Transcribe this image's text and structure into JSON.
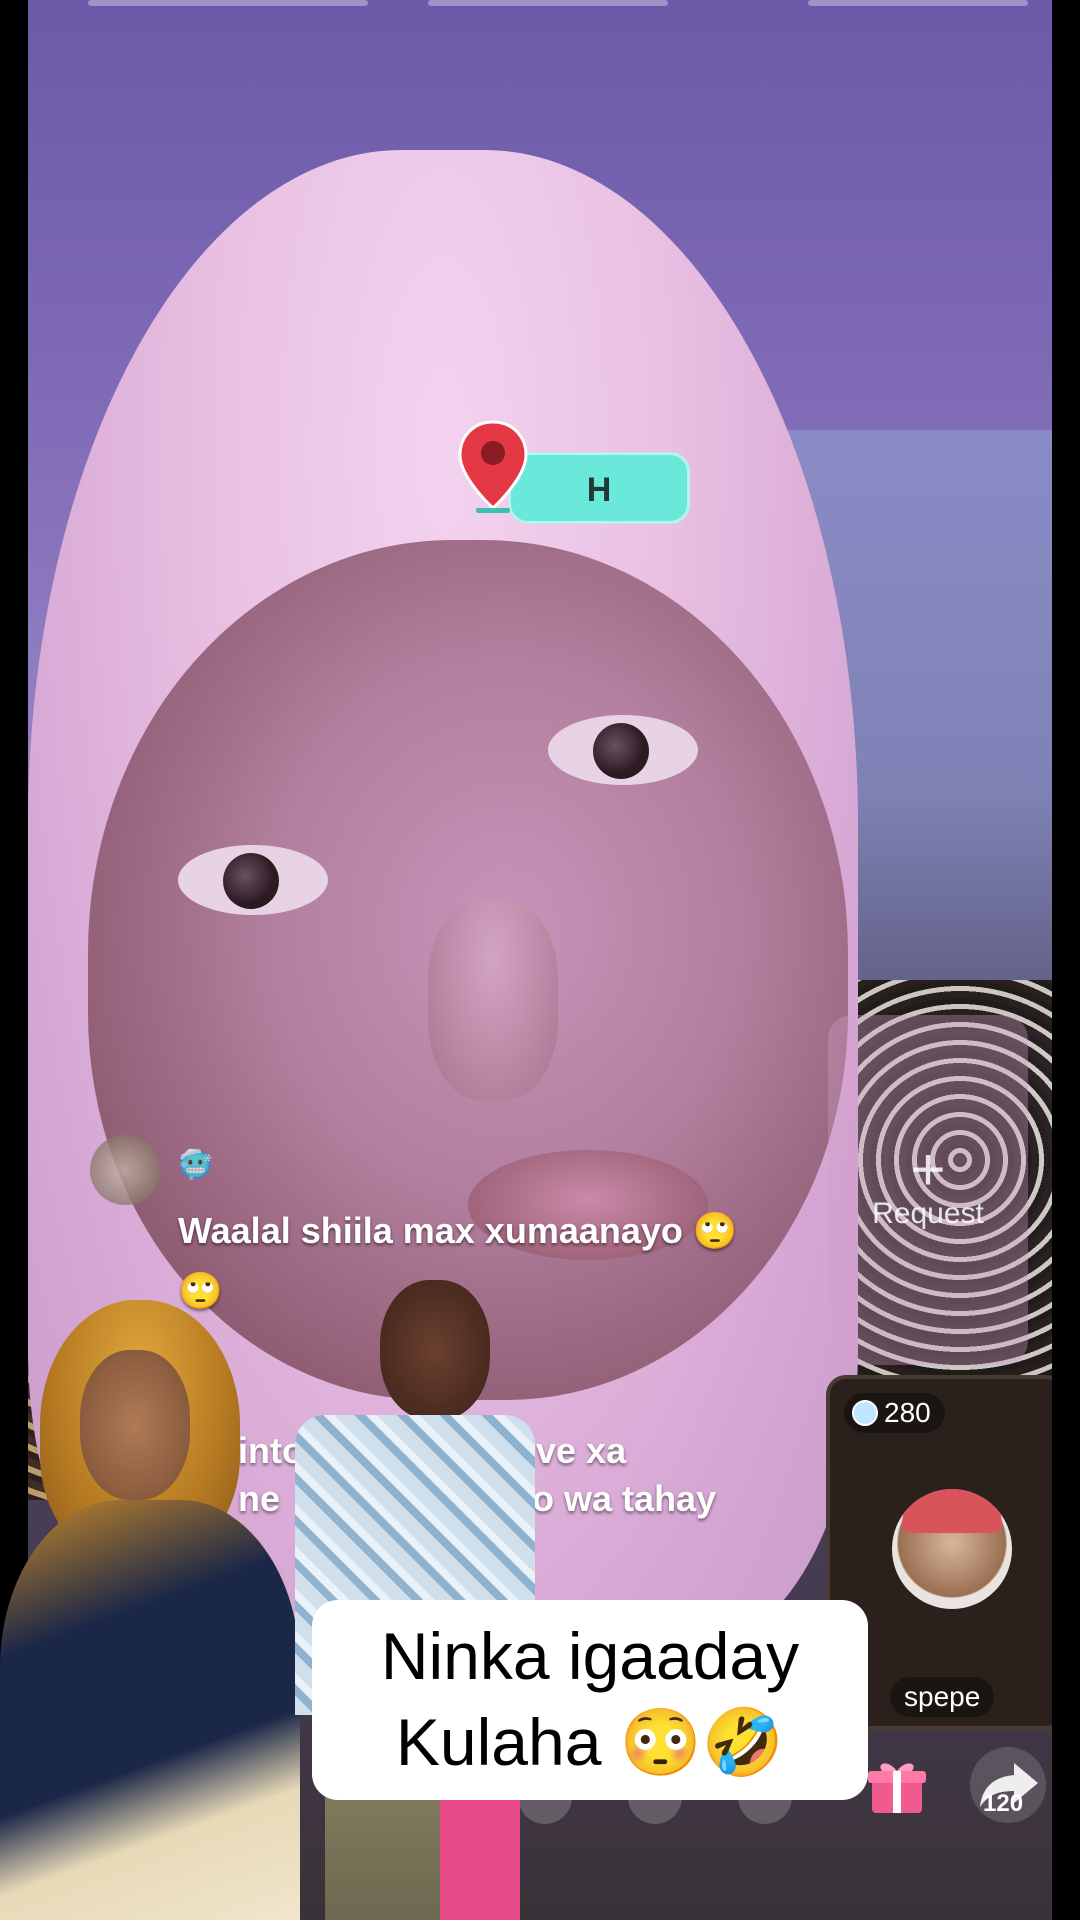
{
  "location_sticker": {
    "label": "H",
    "pin_color": "#e53845",
    "pill_color": "#6ae8da"
  },
  "comments": [
    {
      "line1": "Waalal shiila max xumaanayo 🙄",
      "line2": "🙄"
    },
    {
      "line1": "Go into t",
      "line1_end": "ve xa",
      "line2": "ne",
      "line2_end": "po wa tahay"
    }
  ],
  "request_panel": {
    "icon": "plus-icon",
    "label": "Request"
  },
  "guest": {
    "coin_count": "280",
    "name": "spepe"
  },
  "actions": {
    "share_count": "120"
  },
  "caption": {
    "line1": "Ninka igaaday",
    "line2": "Kulaha 😳🤣"
  },
  "colors": {
    "caption_bg": "#ffffff",
    "accent_pink": "#e84b8a"
  }
}
